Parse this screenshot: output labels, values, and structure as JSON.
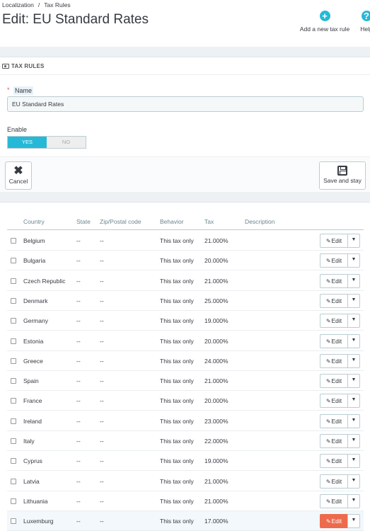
{
  "breadcrumb": [
    "Localization",
    "Tax Rules"
  ],
  "title": "Edit: EU Standard Rates",
  "toolbar": {
    "add_label": "Add a new tax rule",
    "help_label": "Help"
  },
  "panel": {
    "heading": "TAX RULES",
    "name_label": "Name",
    "name_value": "EU Standard Rates",
    "enable_label": "Enable",
    "yes_label": "YES",
    "no_label": "NO",
    "cancel_label": "Cancel",
    "save_label": "Save and stay"
  },
  "table": {
    "headers": [
      "Country",
      "State",
      "Zip/Postal code",
      "Behavior",
      "Tax",
      "Description"
    ],
    "edit_label": "Edit",
    "rows": [
      {
        "country": "Belgium",
        "state": "--",
        "zip": "--",
        "behavior": "This tax only",
        "tax": "21.000%"
      },
      {
        "country": "Bulgaria",
        "state": "--",
        "zip": "--",
        "behavior": "This tax only",
        "tax": "20.000%"
      },
      {
        "country": "Czech Republic",
        "state": "--",
        "zip": "--",
        "behavior": "This tax only",
        "tax": "21.000%"
      },
      {
        "country": "Denmark",
        "state": "--",
        "zip": "--",
        "behavior": "This tax only",
        "tax": "25.000%"
      },
      {
        "country": "Germany",
        "state": "--",
        "zip": "--",
        "behavior": "This tax only",
        "tax": "19.000%"
      },
      {
        "country": "Estonia",
        "state": "--",
        "zip": "--",
        "behavior": "This tax only",
        "tax": "20.000%"
      },
      {
        "country": "Greece",
        "state": "--",
        "zip": "--",
        "behavior": "This tax only",
        "tax": "24.000%"
      },
      {
        "country": "Spain",
        "state": "--",
        "zip": "--",
        "behavior": "This tax only",
        "tax": "21.000%"
      },
      {
        "country": "France",
        "state": "--",
        "zip": "--",
        "behavior": "This tax only",
        "tax": "20.000%"
      },
      {
        "country": "Ireland",
        "state": "--",
        "zip": "--",
        "behavior": "This tax only",
        "tax": "23.000%"
      },
      {
        "country": "Italy",
        "state": "--",
        "zip": "--",
        "behavior": "This tax only",
        "tax": "22.000%"
      },
      {
        "country": "Cyprus",
        "state": "--",
        "zip": "--",
        "behavior": "This tax only",
        "tax": "19.000%"
      },
      {
        "country": "Latvia",
        "state": "--",
        "zip": "--",
        "behavior": "This tax only",
        "tax": "21.000%"
      },
      {
        "country": "Lithuania",
        "state": "--",
        "zip": "--",
        "behavior": "This tax only",
        "tax": "21.000%"
      },
      {
        "country": "Luxemburg",
        "state": "--",
        "zip": "--",
        "behavior": "This tax only",
        "tax": "17.000%"
      }
    ]
  },
  "colors": {
    "accent": "#25b9d7",
    "edit_hover": "#ed6b4c"
  }
}
